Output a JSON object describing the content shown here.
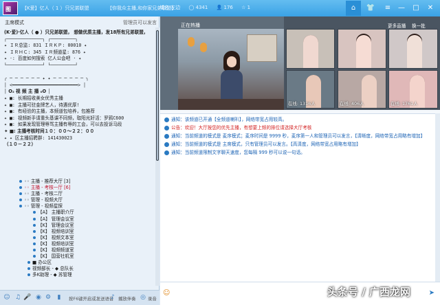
{
  "titlebar": {
    "avatar_text": "图",
    "room": "【K爱】亿人（ 1 ）只兄弟联盟",
    "notice": "【你我众主播,和你家兄弟联盟】",
    "stats": [
      "域名·左边",
      "◯ 4341",
      "👤 176",
      "☆ 1"
    ],
    "buttons": [
      "⌂",
      "👕",
      "≡",
      "—",
      "□",
      "✕"
    ]
  },
  "left": {
    "mode": "主席模式",
    "manage": "管理员可以发言",
    "room_lines": [
      {
        "t": "(K·爱)·亿人（ ● ）只兄弟联盟，  想做优质主播，发18所有兄弟联盟，",
        "c": "bold"
      },
      {
        "t": "      ┌─────────────┐          ┌─────────┐",
        "c": ""
      },
      {
        "t": "  ✦       ＩＲ总监: 831  ＩＲＫＰ: 00010     ✦",
        "c": ""
      },
      {
        "t": "  ✦       ＩＲＨＣ: 345  ＩＲ频道星:  876      ✦",
        "c": ""
      },
      {
        "t": "  ✦       ·: 百度如何搜索 亿人公会吧 ·        ✦",
        "c": ""
      },
      {
        "t": "      └─────────────┘          └─────────┘",
        "c": ""
      },
      {
        "t": "",
        "c": ""
      },
      {
        "t": "  ╭ ─ ─ ─ ─ ─ ─  ✦ ✦  ─ ─ ─ ─ ─ ─ ╮",
        "c": ""
      },
      {
        "t": "  │      <━━━━━━━━━━━━━━━━━━━━━━━━>      │",
        "c": ""
      },
      {
        "t": "  │         O₂  视  频  主  播  ₀O          │",
        "c": "bold"
      },
      {
        "t": "  ✦  ■: 长期招收美女优秀主播",
        "c": ""
      },
      {
        "t": "  ✦  ■: 主播可驻金牌艺人，待遇优厚!",
        "c": ""
      },
      {
        "t": "  ✦  ■: 有经验的主播，本频道包培养，包推荐",
        "c": ""
      },
      {
        "t": "  ✦  ■: 视频新手请重头基课不同频，取阳光好活：罗鸦C600",
        "c": ""
      },
      {
        "t": "  ✦  ■: 如果发现管理辱骂主播有辱的工会，可以去投诉马段",
        "c": ""
      },
      {
        "t": "  ✦  ■: 主播考核时间１０：００～２２：００",
        "c": "bold"
      },
      {
        "t": "  ✦  ✦ 区主播招聘群: 141430023",
        "c": ""
      },
      {
        "t": "       （１０－２２）",
        "c": "bold"
      },
      {
        "t": "",
        "c": ""
      },
      {
        "t": "",
        "c": ""
      },
      {
        "t": "",
        "c": ""
      }
    ],
    "tree": [
      {
        "indent": 28,
        "t": "◦◦      主播 - 推荐大厅   [3]",
        "c": ""
      },
      {
        "indent": 28,
        "t": "◦◦      主播 - 考核一厅   [6]",
        "c": "red"
      },
      {
        "indent": 28,
        "t": "◦◦      主播 - 考核二厅",
        "c": ""
      },
      {
        "indent": 28,
        "t": "◦◦      管理 - 视频大厅",
        "c": ""
      },
      {
        "indent": 28,
        "t": "◦◦      管理 - 视频星探",
        "c": ""
      },
      {
        "indent": 48,
        "t": "【A】     主播职介厅",
        "c": ""
      },
      {
        "indent": 48,
        "t": "【A】     管理会议室",
        "c": ""
      },
      {
        "indent": 48,
        "t": "【K】     管理会议室",
        "c": ""
      },
      {
        "indent": 48,
        "t": "【K】     视频培训室",
        "c": ""
      },
      {
        "indent": 48,
        "t": "【K】     视频文本室",
        "c": ""
      },
      {
        "indent": 48,
        "t": "【K】     视频培训室",
        "c": ""
      },
      {
        "indent": 48,
        "t": "【K】     视频频道室",
        "c": ""
      },
      {
        "indent": 48,
        "t": "【K】     国营社机室",
        "c": ""
      },
      {
        "indent": 40,
        "t": "■ 办公区",
        "c": ""
      },
      {
        "indent": 40,
        "t": "视频部长 -  ◆  总队长",
        "c": ""
      },
      {
        "indent": 40,
        "t": "多K助理 -  ◆  苏管理",
        "c": ""
      }
    ],
    "footer": {
      "hint": "按F6键开启或发送语音",
      "play": "播放伴奏",
      "record": "录音"
    }
  },
  "hot": {
    "label": "正在热播",
    "more": "更多直播",
    "refresh": "换一批",
    "thumbs": [
      "",
      "",
      "",
      "在线: 1316人",
      "在线: 406人",
      "在线: 1761人"
    ]
  },
  "chat": {
    "lines": [
      {
        "pre": "通知：",
        "t": "该频道已开通【全频道喇叭】，网络带宽占用较高。",
        "c": "notice"
      },
      {
        "pre": "公告：",
        "t": "欢迎！大厅按您的优先主播，有想要上频的排位请选择大厅考核",
        "c": "red"
      },
      {
        "pre": "通知：",
        "t": "当前频道的模式是 麦序模式；麦序时间是 9999 秒，麦序第一人和管理员可以发言，【清晰度，网络带宽占用略有增加】",
        "c": "notice"
      },
      {
        "pre": "通知：",
        "t": "当前频道的模式是 主席模式，只有管理员可以发言。【高清度，网络带宽占用略有增加】",
        "c": "notice"
      },
      {
        "pre": "通知：",
        "t": "当前频道限制文字聊天速度，您每隔 999 秒可以说一句话。",
        "c": "notice"
      }
    ]
  },
  "watermark": "头条号 / 广西龙网"
}
